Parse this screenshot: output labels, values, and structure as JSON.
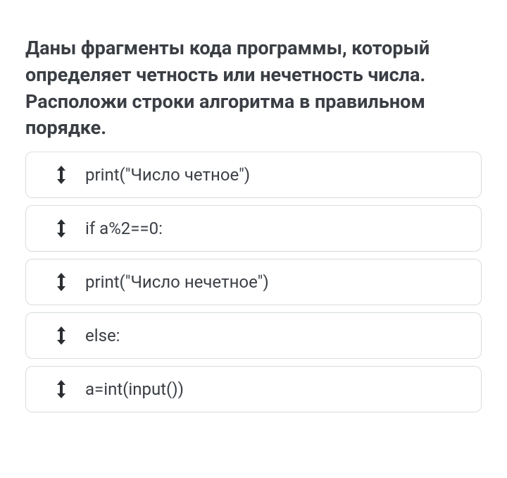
{
  "question": {
    "title": "Даны фрагменты кода программы, который определяет четность или нечетность числа. Расположи строки алгоритма в правильном порядке."
  },
  "items": [
    {
      "text": "print(\"Число четное\")"
    },
    {
      "text": "if a%2==0:"
    },
    {
      "text": "print(\"Число нечетное\")"
    },
    {
      "text": "else:"
    },
    {
      "text": "a=int(input())"
    }
  ]
}
